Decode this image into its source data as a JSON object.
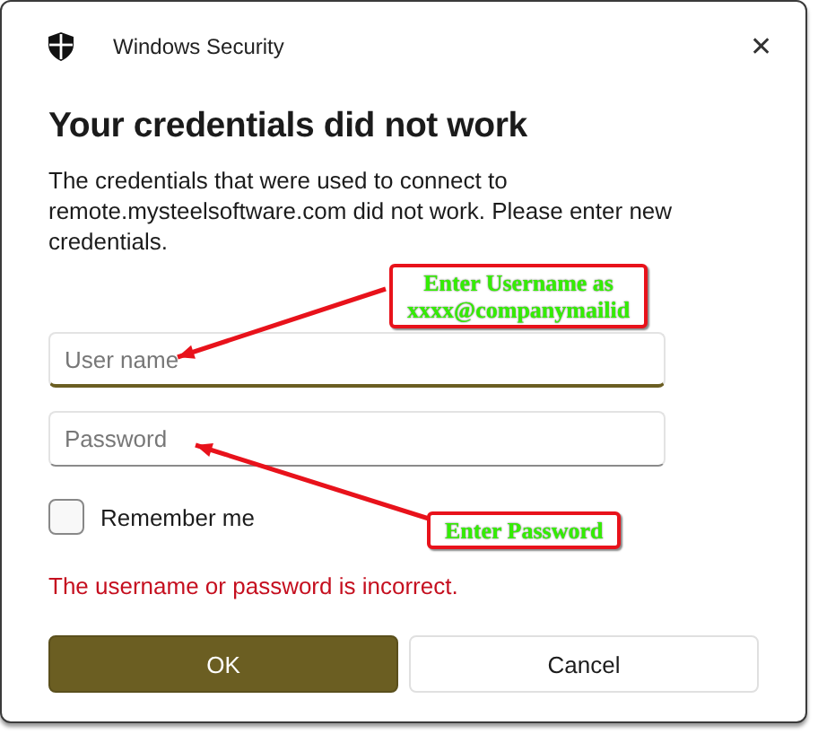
{
  "window": {
    "title": "Windows Security",
    "close": "✕"
  },
  "heading": "Your credentials did not work",
  "message": "The credentials that were used to connect to remote.mysteelsoftware.com did not work. Please enter new credentials.",
  "fields": [
    {
      "placeholder": "User name",
      "focused": true
    },
    {
      "placeholder": "Password",
      "focused": false
    }
  ],
  "remember": {
    "label": "Remember me",
    "checked": false
  },
  "error": "The username or password is incorrect.",
  "buttons": [
    {
      "label": "OK",
      "kind": "primary"
    },
    {
      "label": "Cancel",
      "kind": "secondary"
    }
  ],
  "annotations": [
    {
      "lines": [
        "Enter Username as",
        "xxxx@companymailid"
      ]
    },
    {
      "lines": [
        "Enter Password"
      ]
    }
  ]
}
